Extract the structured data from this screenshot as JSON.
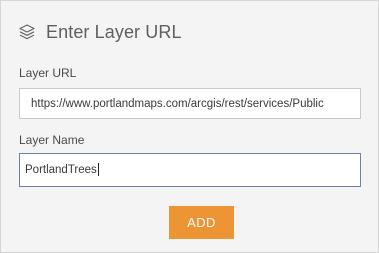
{
  "dialog": {
    "title": "Enter Layer URL",
    "icon": "layers-icon"
  },
  "url_field": {
    "label": "Layer URL",
    "value": "https://www.portlandmaps.com/arcgis/rest/services/Public"
  },
  "name_field": {
    "label": "Layer Name",
    "value": "PortlandTrees"
  },
  "add_button": {
    "label": "ADD",
    "color": "#ed9435"
  }
}
